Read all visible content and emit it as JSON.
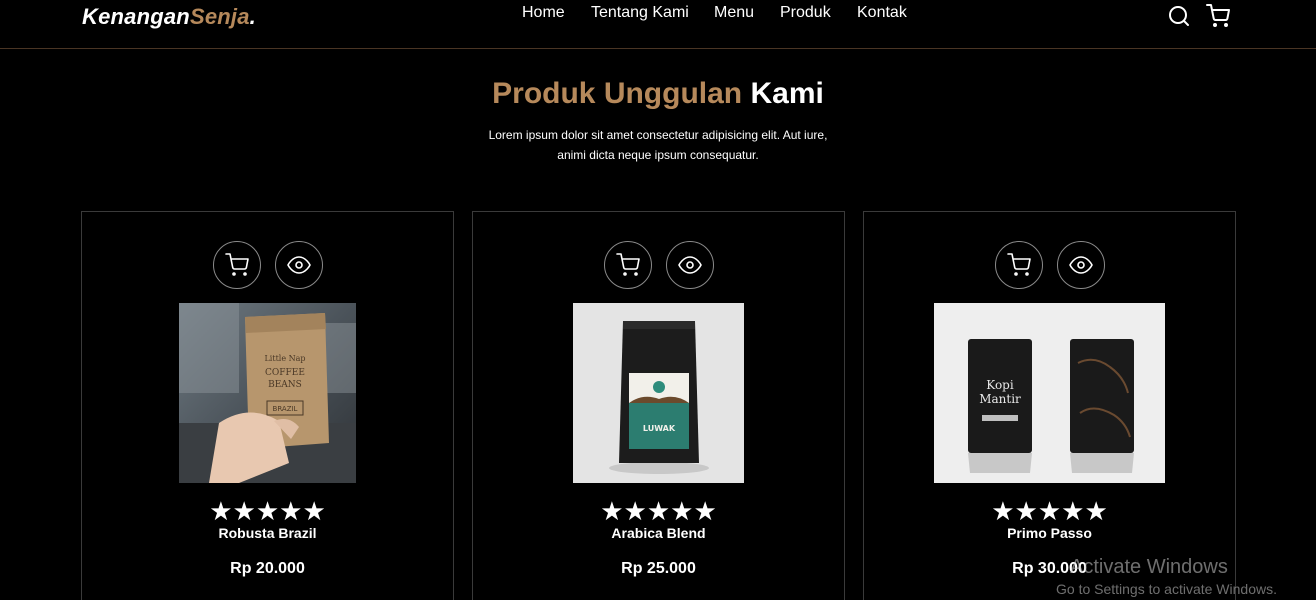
{
  "navbar": {
    "logo_main": "Kenangan",
    "logo_accent": "Senja",
    "logo_dot": ".",
    "links": [
      "Home",
      "Tentang Kami",
      "Menu",
      "Produk",
      "Kontak"
    ],
    "icons": [
      "search-icon",
      "shopping-cart-icon"
    ]
  },
  "section": {
    "title_accent": "Produk Unggulan",
    "title_rest": "Kami",
    "description": "Lorem ipsum dolor sit amet consectetur adipisicing elit. Aut iure, animi dicta neque ipsum consequatur."
  },
  "products": [
    {
      "name": "Robusta Brazil",
      "price": "Rp 20.000",
      "rating": 5,
      "image": "kraft-paper-coffee-bag-in-hand"
    },
    {
      "name": "Arabica Blend",
      "price": "Rp 25.000",
      "rating": 5,
      "image": "black-luwak-coffee-pouch"
    },
    {
      "name": "Primo Passo",
      "price": "Rp 30.000",
      "rating": 5,
      "image": "black-kopi-mantir-bags"
    }
  ],
  "stars": "★★★★★",
  "watermark": {
    "title": "Activate Windows",
    "subtitle": "Go to Settings to activate Windows."
  },
  "colors": {
    "accent": "#b6895b",
    "background": "#000000",
    "text": "#ffffff"
  }
}
